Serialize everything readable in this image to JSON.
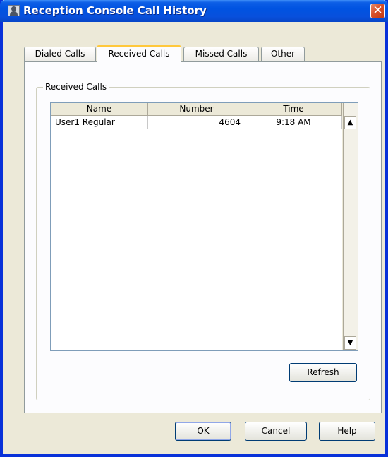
{
  "window": {
    "title": "Reception Console Call History",
    "close_glyph": "✕"
  },
  "tabs": [
    {
      "label": "Dialed Calls",
      "active": false
    },
    {
      "label": "Received Calls",
      "active": true
    },
    {
      "label": "Missed Calls",
      "active": false
    },
    {
      "label": "Other",
      "active": false
    }
  ],
  "panel": {
    "group_label": "Received Calls",
    "columns": [
      "Name",
      "Number",
      "Time"
    ],
    "rows": [
      {
        "name": "User1 Regular",
        "number": "4604",
        "time": "9:18 AM"
      }
    ],
    "scroll_up_glyph": "▲",
    "scroll_down_glyph": "▼",
    "refresh_label": "Refresh"
  },
  "footer": {
    "ok_label": "OK",
    "cancel_label": "Cancel",
    "help_label": "Help"
  },
  "colors": {
    "titlebar": "#0053e1",
    "frame": "#0831d9",
    "face": "#ece9d8",
    "active_tab_accent": "#ffc83c"
  }
}
